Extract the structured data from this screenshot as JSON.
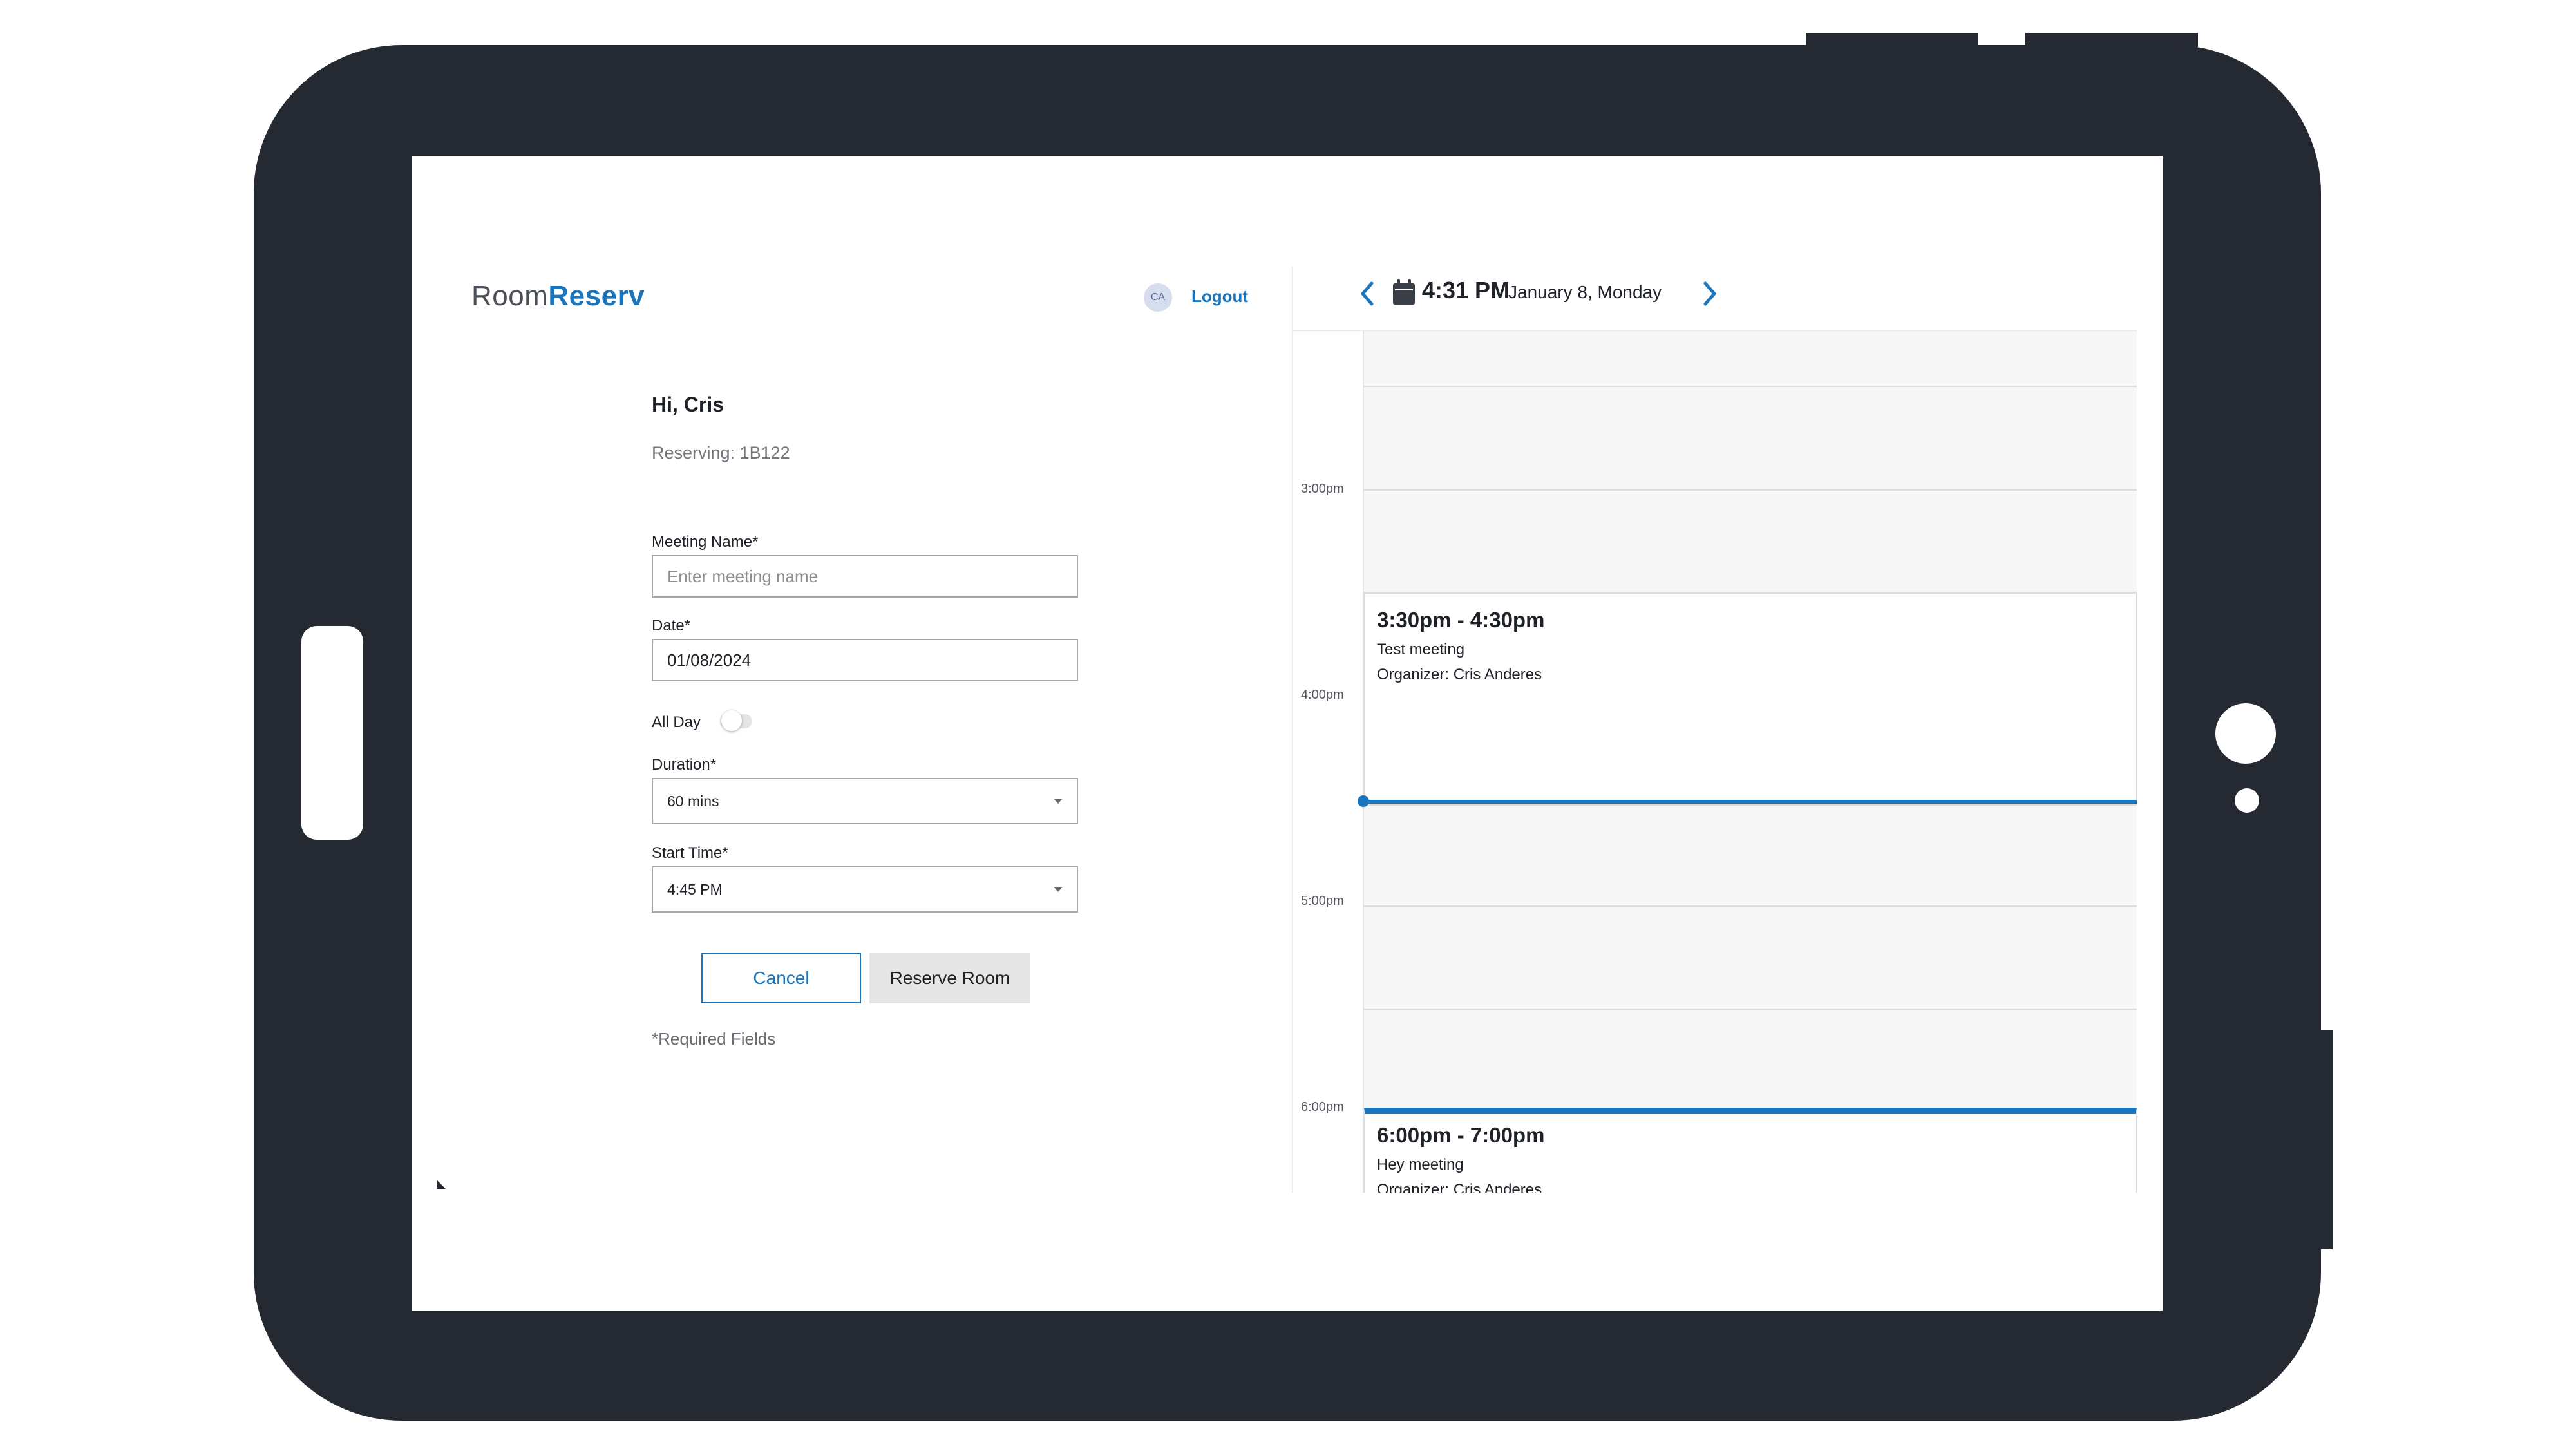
{
  "app": {
    "logo_prefix": "Room",
    "logo_brand": "Reserv",
    "avatar_initials": "CA",
    "logout_label": "Logout"
  },
  "form": {
    "greeting": "Hi, Cris",
    "reserving": "Reserving: 1B122",
    "meeting_name_label": "Meeting Name*",
    "meeting_name_placeholder": "Enter meeting name",
    "date_label": "Date*",
    "date_value": "01/08/2024",
    "all_day_label": "All Day",
    "all_day_on": false,
    "duration_label": "Duration*",
    "duration_value": "60 mins",
    "start_time_label": "Start Time*",
    "start_time_value": "4:45 PM",
    "cancel_label": "Cancel",
    "reserve_label": "Reserve Room",
    "required_note": "*Required Fields"
  },
  "calendar": {
    "current_time": "4:31 PM",
    "current_date": "January 8, Monday",
    "time_labels": [
      "3:00pm",
      "4:00pm",
      "5:00pm",
      "6:00pm"
    ],
    "events": [
      {
        "time": "3:30pm - 4:30pm",
        "name": "Test meeting",
        "organizer": "Organizer: Cris Anderes"
      },
      {
        "time": "6:00pm - 7:00pm",
        "name": "Hey meeting",
        "organizer": "Organizer: Cris Anderes"
      }
    ]
  },
  "colors": {
    "accent": "#1b75bc",
    "frame": "#252932",
    "calendar_bg": "#f7f7f7"
  }
}
